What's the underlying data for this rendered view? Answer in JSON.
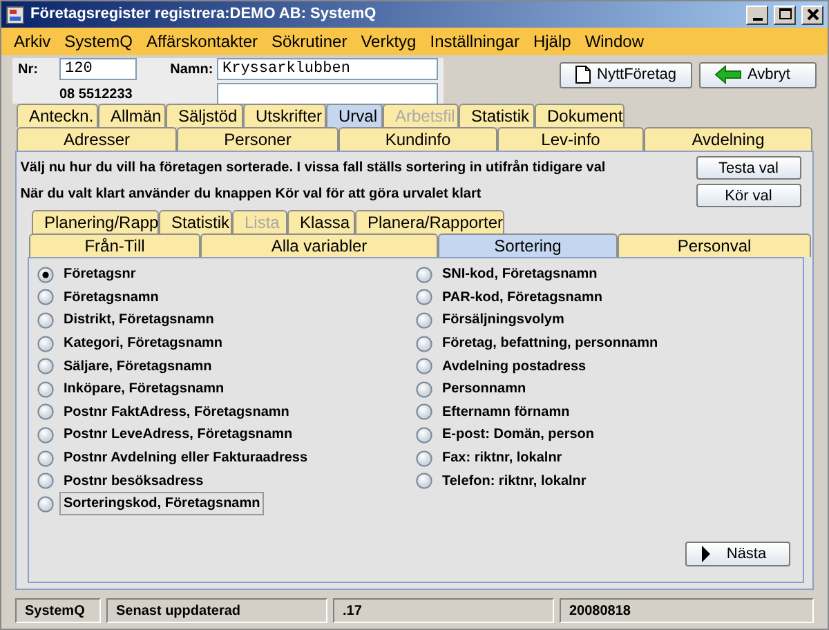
{
  "window": {
    "title": "Företagsregister registrera:DEMO AB: SystemQ"
  },
  "menu": [
    "Arkiv",
    "SystemQ",
    "Affärskontakter",
    "Sökrutiner",
    "Verktyg",
    "Inställningar",
    "Hjälp",
    "Window"
  ],
  "header": {
    "nr_label": "Nr:",
    "nr_value": "120",
    "name_label": "Namn:",
    "name_value": "Kryssarklubben",
    "phone": "08 5512233",
    "buttons": [
      {
        "label": "NyttFöretag",
        "kind": "document"
      },
      {
        "label": "Avbryt",
        "kind": "back"
      }
    ]
  },
  "tabs_row_1": [
    {
      "label": "Anteckn.",
      "selected": false,
      "disabled": false
    },
    {
      "label": "Allmän",
      "selected": false,
      "disabled": false
    },
    {
      "label": "Säljstöd",
      "selected": false,
      "disabled": false
    },
    {
      "label": "Utskrifter",
      "selected": false,
      "disabled": false
    },
    {
      "label": "Urval",
      "selected": true,
      "disabled": false
    },
    {
      "label": "Arbetsfil",
      "selected": false,
      "disabled": true
    },
    {
      "label": "Statistik",
      "selected": false,
      "disabled": false
    },
    {
      "label": "Dokument",
      "selected": false,
      "disabled": false
    }
  ],
  "tabs_row_2": [
    {
      "label": "Adresser",
      "selected": false,
      "disabled": false
    },
    {
      "label": "Personer",
      "selected": false,
      "disabled": false
    },
    {
      "label": "Kundinfo",
      "selected": false,
      "disabled": false
    },
    {
      "label": "Lev-info",
      "selected": false,
      "disabled": false
    },
    {
      "label": "Avdelning",
      "selected": false,
      "disabled": false
    }
  ],
  "instructions": [
    "Välj nu hur du vill ha företagen sorterade. I vissa fall ställs sortering in utifrån tidigare val",
    "När du valt klart använder du knappen Kör val för att göra urvalet klart"
  ],
  "action_buttons": [
    "Testa val",
    "Kör val"
  ],
  "inner_tabs_row_1": [
    {
      "label": "Planering/Rapp",
      "selected": false,
      "disabled": false
    },
    {
      "label": "Statistik",
      "selected": false,
      "disabled": false
    },
    {
      "label": "Lista",
      "selected": false,
      "disabled": true
    },
    {
      "label": "Klassa",
      "selected": false,
      "disabled": false
    },
    {
      "label": "Planera/Rapporter",
      "selected": false,
      "disabled": false
    }
  ],
  "inner_tabs_row_2": [
    {
      "label": "Från-Till",
      "selected": false,
      "disabled": false
    },
    {
      "label": "Alla variabler",
      "selected": false,
      "disabled": false
    },
    {
      "label": "Sortering",
      "selected": true,
      "disabled": false
    },
    {
      "label": "Personval",
      "selected": false,
      "disabled": false
    }
  ],
  "sort_options_left": [
    {
      "label": "Företagsnr",
      "selected": true,
      "focused": false
    },
    {
      "label": "Företagsnamn",
      "selected": false,
      "focused": false
    },
    {
      "label": "Distrikt, Företagsnamn",
      "selected": false,
      "focused": false
    },
    {
      "label": "Kategori, Företagsnamn",
      "selected": false,
      "focused": false
    },
    {
      "label": "Säljare, Företagsnamn",
      "selected": false,
      "focused": false
    },
    {
      "label": "Inköpare, Företagsnamn",
      "selected": false,
      "focused": false
    },
    {
      "label": "Postnr FaktAdress, Företagsnamn",
      "selected": false,
      "focused": false
    },
    {
      "label": "Postnr LeveAdress, Företagsnamn",
      "selected": false,
      "focused": false
    },
    {
      "label": "Postnr Avdelning eller Fakturaadress",
      "selected": false,
      "focused": false
    },
    {
      "label": "Postnr besöksadress",
      "selected": false,
      "focused": false
    },
    {
      "label": "Sorteringskod, Företagsnamn",
      "selected": false,
      "focused": true
    }
  ],
  "sort_options_right": [
    {
      "label": "SNI-kod, Företagsnamn",
      "selected": false,
      "focused": false
    },
    {
      "label": "PAR-kod, Företagsnamn",
      "selected": false,
      "focused": false
    },
    {
      "label": "Försäljningsvolym",
      "selected": false,
      "focused": false
    },
    {
      "label": "Företag, befattning, personnamn",
      "selected": false,
      "focused": false
    },
    {
      "label": "Avdelning postadress",
      "selected": false,
      "focused": false
    },
    {
      "label": "Personnamn",
      "selected": false,
      "focused": false
    },
    {
      "label": "Efternamn förnamn",
      "selected": false,
      "focused": false
    },
    {
      "label": "E-post: Domän, person",
      "selected": false,
      "focused": false
    },
    {
      "label": "Fax: riktnr, lokalnr",
      "selected": false,
      "focused": false
    },
    {
      "label": "Telefon: riktnr, lokalnr",
      "selected": false,
      "focused": false
    }
  ],
  "next_button": "Nästa",
  "status_bar": [
    "SystemQ",
    "Senast uppdaterad",
    ".17",
    "20080818"
  ]
}
